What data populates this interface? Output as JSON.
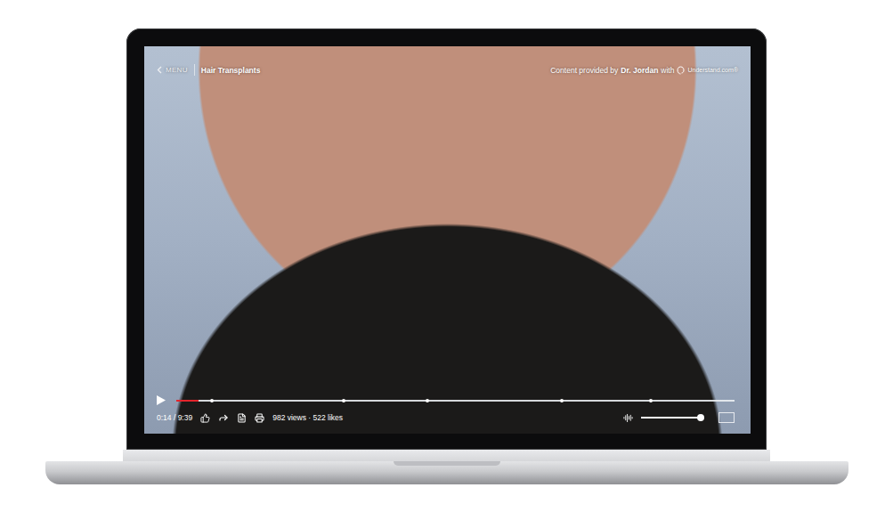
{
  "player": {
    "menu": "MENU",
    "title": "Hair Transplants",
    "credit": {
      "prefix": "Content provided by",
      "author": "Dr. Jordan",
      "joiner": "with",
      "brand": "Understand.com®"
    },
    "video": {
      "playing": false
    },
    "progress": {
      "level": 0.04,
      "markers": [
        0.064,
        0.3,
        0.45,
        0.69,
        0.85
      ]
    },
    "time": "0:14 / 9:39",
    "stats": "982 views · 522 likes",
    "volume": {
      "level": 0.95
    }
  }
}
